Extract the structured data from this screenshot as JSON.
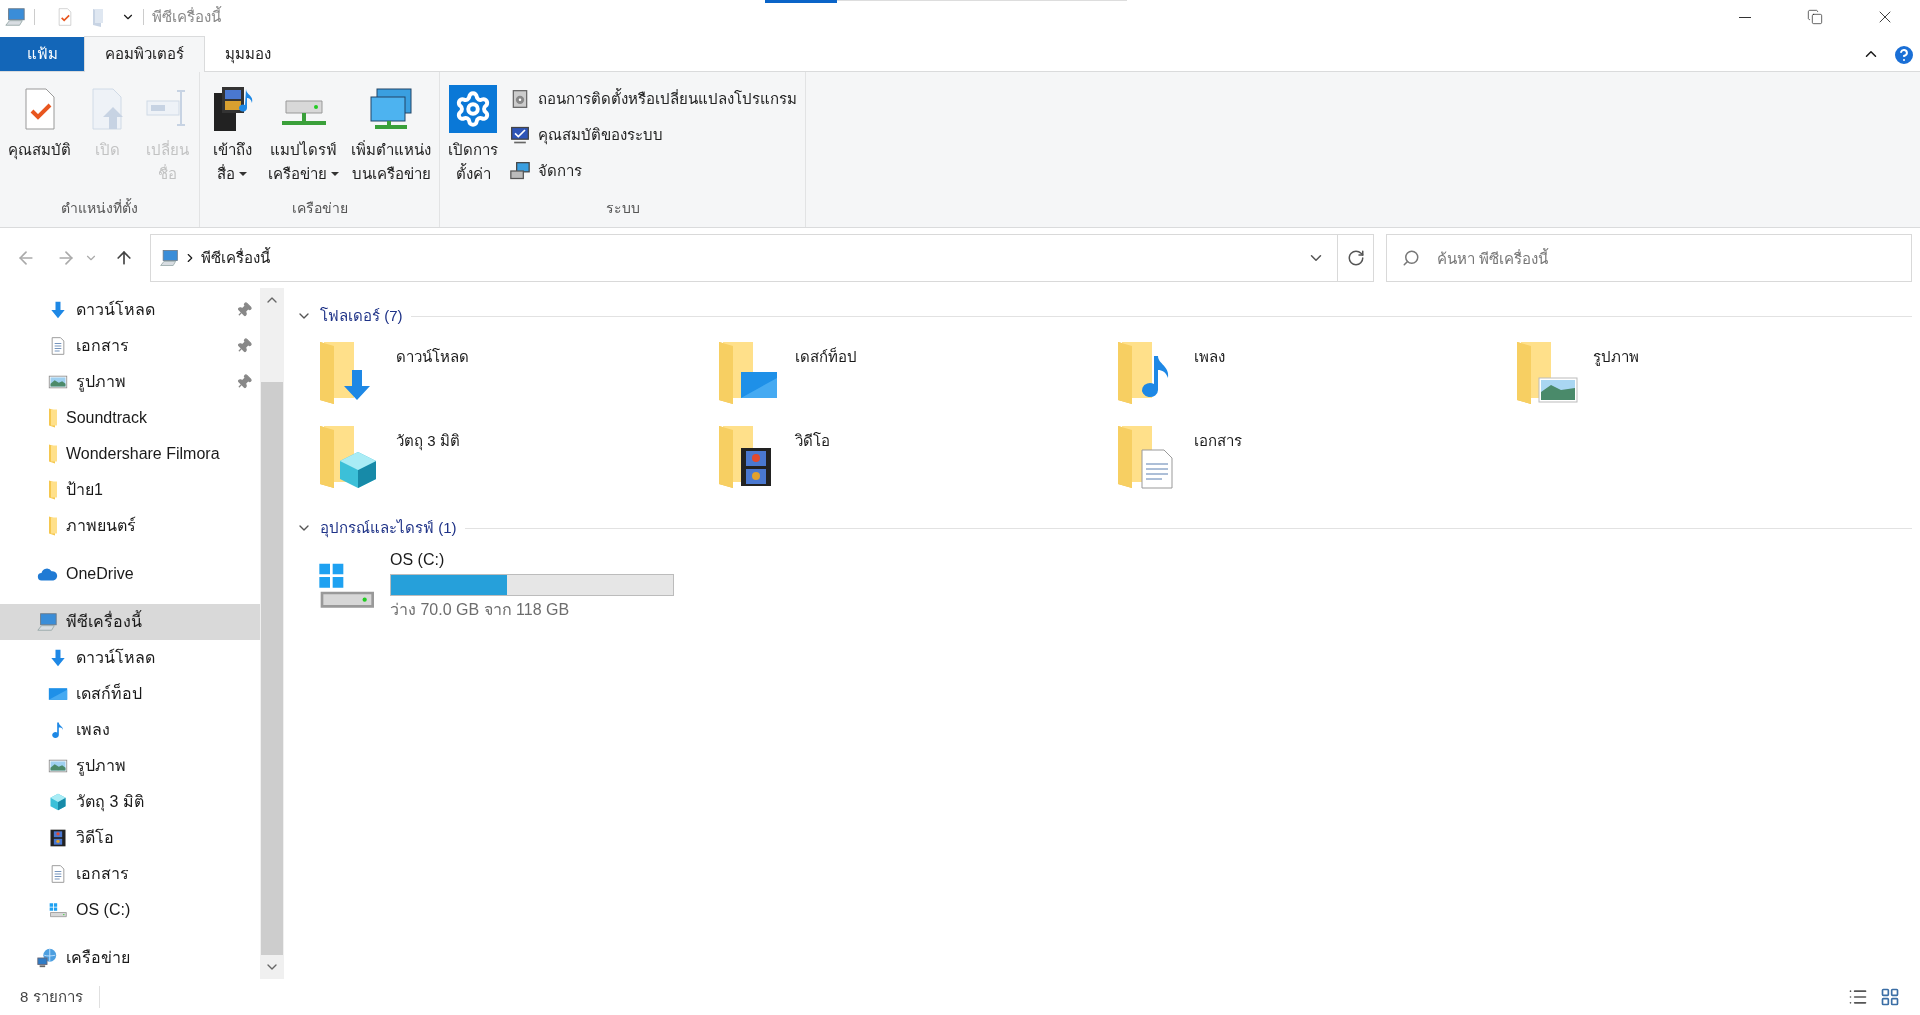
{
  "title_bar": {
    "title": "พีซีเครื่องนี้"
  },
  "ribbon": {
    "tabs": [
      {
        "label": "แฟ้ม",
        "kind": "file",
        "selected": false
      },
      {
        "label": "คอมพิวเตอร์",
        "kind": "tab",
        "selected": true
      },
      {
        "label": "มุมมอง",
        "kind": "tab",
        "selected": false
      }
    ],
    "groups": [
      {
        "label": "ตำแหน่งที่ตั้ง",
        "buttons": [
          {
            "kind": "properties",
            "lines": [
              "คุณสมบัติ"
            ],
            "dropdown": false,
            "disabled": false
          },
          {
            "kind": "open",
            "lines": [
              "เปิด"
            ],
            "dropdown": false,
            "disabled": true
          },
          {
            "kind": "rename",
            "lines": [
              "เปลี่ยน",
              "ชื่อ"
            ],
            "dropdown": false,
            "disabled": true
          }
        ]
      },
      {
        "label": "เครือข่าย",
        "buttons": [
          {
            "kind": "media",
            "lines": [
              "เข้าถึง",
              "สื่อ"
            ],
            "dropdown": true,
            "disabled": false
          },
          {
            "kind": "mapdrive",
            "lines": [
              "แมปไดรฟ์",
              "เครือข่าย"
            ],
            "dropdown": true,
            "disabled": false
          },
          {
            "kind": "netlocation",
            "lines": [
              "เพิ่มตำแหน่ง",
              "บนเครือข่าย"
            ],
            "dropdown": false,
            "disabled": false
          }
        ]
      },
      {
        "label": "ระบบ",
        "buttons": [
          {
            "kind": "settings",
            "lines": [
              "เปิดการ",
              "ตั้งค่า"
            ],
            "dropdown": false,
            "disabled": false
          }
        ],
        "links": [
          {
            "kind": "uninstall",
            "label": "ถอนการติดตั้งหรือเปลี่ยนแปลงโปรแกรม"
          },
          {
            "kind": "sysprops",
            "label": "คุณสมบัติของระบบ"
          },
          {
            "kind": "manage",
            "label": "จัดการ"
          }
        ]
      }
    ]
  },
  "address_bar": {
    "path": "พีซีเครื่องนี้"
  },
  "search": {
    "placeholder": "ค้นหา พีซีเครื่องนี้"
  },
  "navigation": {
    "quick_access": [
      {
        "label": "ดาวน์โหลด",
        "kind": "download",
        "pinned": true
      },
      {
        "label": "เอกสาร",
        "kind": "document",
        "pinned": true
      },
      {
        "label": "รูปภาพ",
        "kind": "picture",
        "pinned": true
      },
      {
        "label": "Soundtrack",
        "kind": "folder",
        "pinned": false
      },
      {
        "label": "Wondershare Filmora",
        "kind": "folder",
        "pinned": false
      },
      {
        "label": "ป้าย1",
        "kind": "folder",
        "pinned": false
      },
      {
        "label": "ภาพยนตร์",
        "kind": "folder",
        "pinned": false
      }
    ],
    "locations": [
      {
        "label": "OneDrive",
        "kind": "onedrive",
        "selected": false
      },
      {
        "label": "พีซีเครื่องนี้",
        "kind": "pc",
        "selected": true,
        "children": [
          {
            "label": "ดาวน์โหลด",
            "kind": "download"
          },
          {
            "label": "เดสก์ท็อป",
            "kind": "desktop"
          },
          {
            "label": "เพลง",
            "kind": "music"
          },
          {
            "label": "รูปภาพ",
            "kind": "picture"
          },
          {
            "label": "วัตถุ 3 มิติ",
            "kind": "objects3d"
          },
          {
            "label": "วิดีโอ",
            "kind": "video"
          },
          {
            "label": "เอกสาร",
            "kind": "document"
          },
          {
            "label": "OS (C:)",
            "kind": "drive"
          }
        ]
      },
      {
        "label": "เครือข่าย",
        "kind": "network",
        "selected": false
      }
    ]
  },
  "sections": [
    {
      "kind": "folders",
      "title": "โฟลเดอร์ (7)",
      "expanded": true,
      "items": [
        {
          "name": "ดาวน์โหลด",
          "kind": "download"
        },
        {
          "name": "เดสก์ท็อป",
          "kind": "desktop"
        },
        {
          "name": "เพลง",
          "kind": "music"
        },
        {
          "name": "รูปภาพ",
          "kind": "picture"
        },
        {
          "name": "วัตถุ 3 มิติ",
          "kind": "objects3d"
        },
        {
          "name": "วิดีโอ",
          "kind": "video"
        },
        {
          "name": "เอกสาร",
          "kind": "document"
        }
      ]
    },
    {
      "kind": "drives",
      "title": "อุปกรณ์และไดรฟ์ (1)",
      "expanded": true,
      "items": [
        {
          "name": "OS (C:)",
          "level": 0.41,
          "space": "ว่าง 70.0 GB จาก 118 GB"
        }
      ]
    }
  ],
  "status_bar": {
    "item_count": "8 รายการ"
  }
}
